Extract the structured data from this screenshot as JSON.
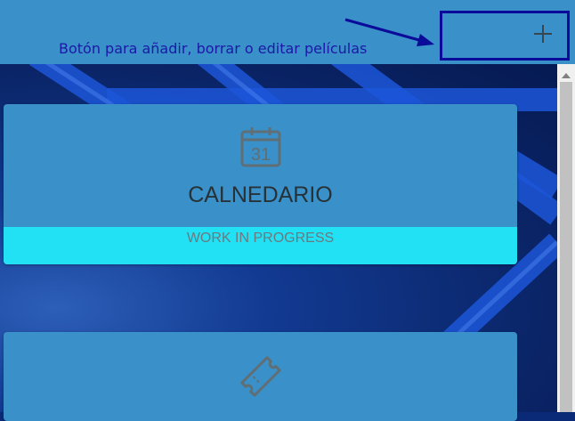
{
  "annotation": {
    "text": "Botón para añadir, borrar o editar películas"
  },
  "header": {
    "add_icon": "plus-icon"
  },
  "cards": [
    {
      "icon": "calendar-icon",
      "icon_number": "31",
      "title": "CALNEDARIO",
      "status": "WORK IN PROGRESS"
    },
    {
      "icon": "ticket-icon",
      "title": "",
      "status": ""
    }
  ],
  "colors": {
    "header_bg": "#3a90c8",
    "card_bg": "#3a90c8",
    "status_bg": "#22e1f4",
    "annotation": "#1a1aa6",
    "annotation_box": "#0b0b9a",
    "background": "#0a2a78"
  }
}
